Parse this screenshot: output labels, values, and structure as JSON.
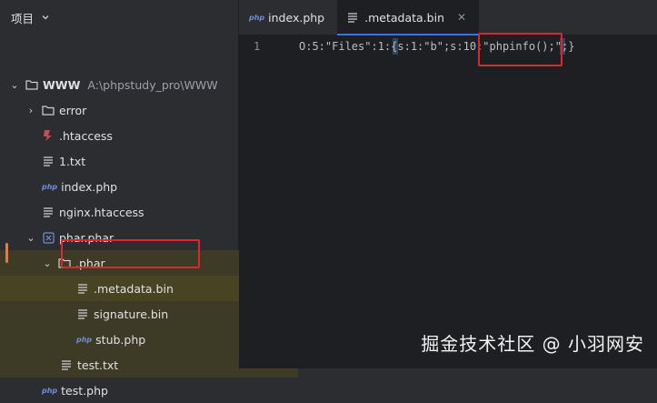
{
  "sidebar": {
    "title": "项目",
    "items": [
      {
        "label": "WWW",
        "path": "A:\\phpstudy_pro\\WWW"
      },
      {
        "label": "error"
      },
      {
        "label": ".htaccess"
      },
      {
        "label": "1.txt"
      },
      {
        "label": "index.php"
      },
      {
        "label": "nginx.htaccess"
      },
      {
        "label": "phar.phar"
      },
      {
        "label": ".phar"
      },
      {
        "label": ".metadata.bin"
      },
      {
        "label": "signature.bin"
      },
      {
        "label": "stub.php"
      },
      {
        "label": "test.txt"
      },
      {
        "label": "test.php"
      }
    ],
    "php_icon_text": "php"
  },
  "tabs": [
    {
      "label": "index.php"
    },
    {
      "label": ".metadata.bin"
    }
  ],
  "editor": {
    "line_number": "1",
    "code": "O:5:\"Files\":1:{s:1:\"b\";s:10:\"phpinfo();\";}"
  },
  "watermark": "掘金技术社区 @ 小羽网安",
  "colors": {
    "accent": "#3574f0",
    "highlight": "#e0262b",
    "modified": "#e27c4a"
  }
}
